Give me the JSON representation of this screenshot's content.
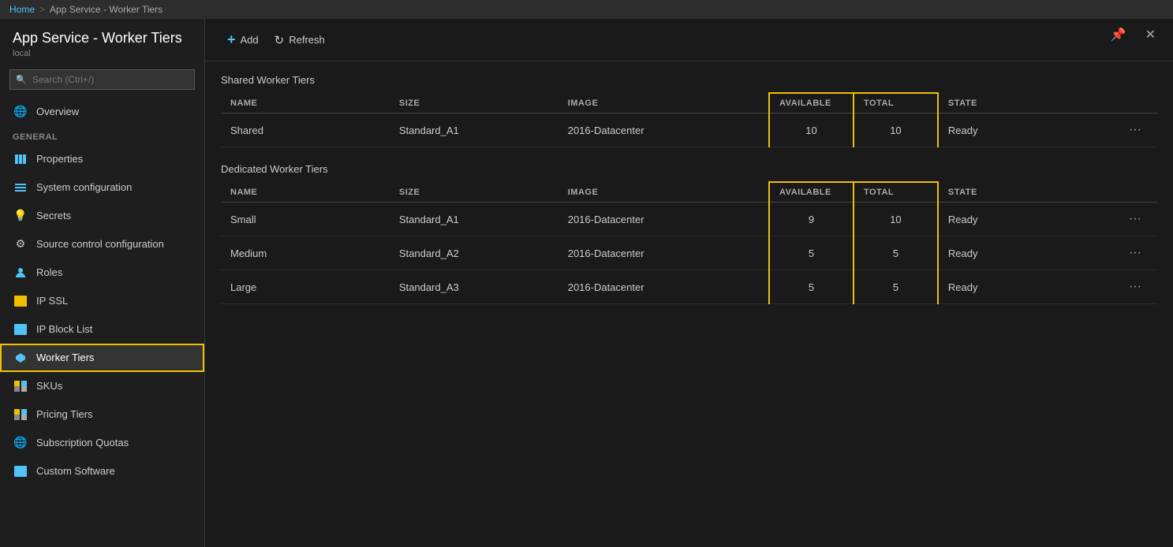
{
  "breadcrumb": {
    "home": "Home",
    "separator": ">",
    "current": "App Service - Worker Tiers"
  },
  "sidebar": {
    "title": "App Service - Worker Tiers",
    "subtitle": "local",
    "search_placeholder": "Search (Ctrl+/)",
    "sections": [
      {
        "label": "",
        "items": [
          {
            "id": "overview",
            "label": "Overview",
            "icon": "🌐"
          }
        ]
      },
      {
        "label": "GENERAL",
        "items": [
          {
            "id": "properties",
            "label": "Properties",
            "icon": "▦"
          },
          {
            "id": "system-configuration",
            "label": "System configuration",
            "icon": "≡"
          },
          {
            "id": "secrets",
            "label": "Secrets",
            "icon": "💡"
          },
          {
            "id": "source-control",
            "label": "Source control configuration",
            "icon": "⚙"
          },
          {
            "id": "roles",
            "label": "Roles",
            "icon": "👤"
          },
          {
            "id": "ip-ssl",
            "label": "IP SSL",
            "icon": "🟨"
          },
          {
            "id": "ip-block-list",
            "label": "IP Block List",
            "icon": "🟦"
          },
          {
            "id": "worker-tiers",
            "label": "Worker Tiers",
            "icon": "✦",
            "active": true
          },
          {
            "id": "skus",
            "label": "SKUs",
            "icon": "▦"
          },
          {
            "id": "pricing-tiers",
            "label": "Pricing Tiers",
            "icon": "▦"
          },
          {
            "id": "subscription-quotas",
            "label": "Subscription Quotas",
            "icon": "🌐"
          },
          {
            "id": "custom-software",
            "label": "Custom Software",
            "icon": "🟦"
          }
        ]
      }
    ]
  },
  "toolbar": {
    "add_label": "Add",
    "refresh_label": "Refresh"
  },
  "shared_worker_tiers": {
    "heading": "Shared Worker Tiers",
    "columns": {
      "name": "NAME",
      "size": "SIZE",
      "image": "IMAGE",
      "available": "AVAILABLE",
      "total": "TOTAL",
      "state": "STATE"
    },
    "rows": [
      {
        "name": "Shared",
        "size": "Standard_A1",
        "image": "2016-Datacenter",
        "available": "10",
        "total": "10",
        "state": "Ready"
      }
    ]
  },
  "dedicated_worker_tiers": {
    "heading": "Dedicated Worker Tiers",
    "columns": {
      "name": "NAME",
      "size": "SIZE",
      "image": "IMAGE",
      "available": "AVAILABLE",
      "total": "TOTAL",
      "state": "STATE"
    },
    "rows": [
      {
        "name": "Small",
        "size": "Standard_A1",
        "image": "2016-Datacenter",
        "available": "9",
        "total": "10",
        "state": "Ready"
      },
      {
        "name": "Medium",
        "size": "Standard_A2",
        "image": "2016-Datacenter",
        "available": "5",
        "total": "5",
        "state": "Ready"
      },
      {
        "name": "Large",
        "size": "Standard_A3",
        "image": "2016-Datacenter",
        "available": "5",
        "total": "5",
        "state": "Ready"
      }
    ]
  },
  "window_controls": {
    "pin": "📌",
    "close": "✕"
  }
}
